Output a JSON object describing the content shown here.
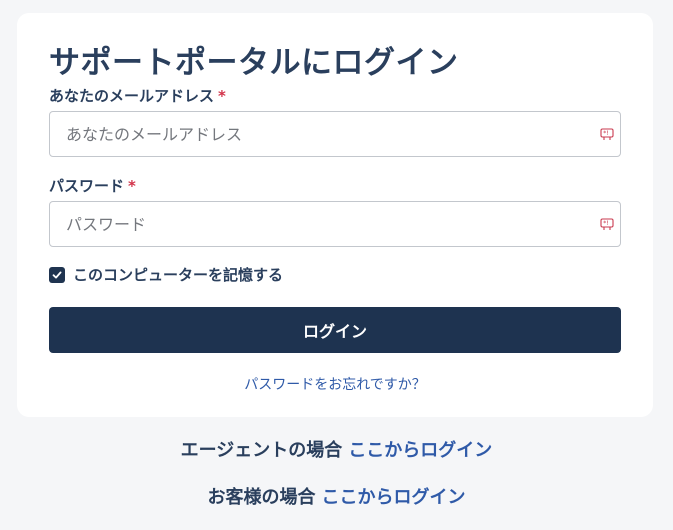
{
  "login": {
    "title": "サポートポータルにログイン",
    "email": {
      "label": "あなたのメールアドレス",
      "required_mark": "*",
      "placeholder": "あなたのメールアドレス",
      "value": ""
    },
    "password": {
      "label": "パスワード",
      "required_mark": "*",
      "placeholder": "パスワード",
      "value": ""
    },
    "remember": {
      "label": "このコンピューターを記憶する",
      "checked": true
    },
    "submit_label": "ログイン",
    "forgot_link": "パスワードをお忘れですか？"
  },
  "footer": {
    "agent_prefix": "エージェントの場合",
    "agent_link": "ここからログイン",
    "customer_prefix": "お客様の場合",
    "customer_link": "ここからログイン"
  },
  "icons": {
    "password_manager": "password-manager-icon",
    "checkmark": "check-icon"
  },
  "colors": {
    "primary": "#1e3350",
    "link": "#2f5aa8",
    "required": "#d2334a",
    "background": "#f5f6f8"
  }
}
